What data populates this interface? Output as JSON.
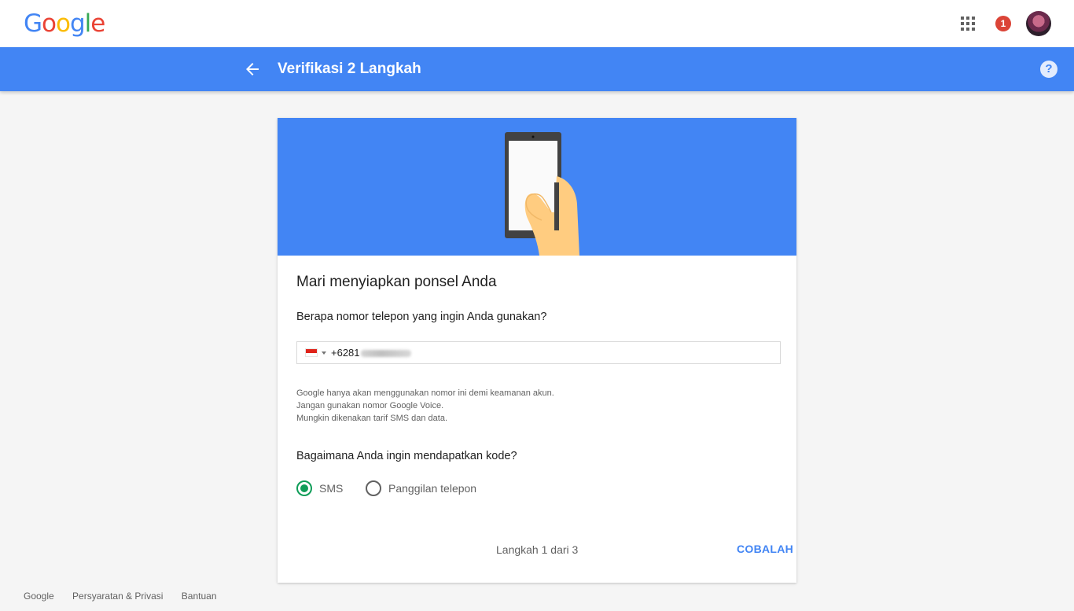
{
  "header": {
    "logo_letters": [
      {
        "char": "G",
        "color": "#4285f4"
      },
      {
        "char": "o",
        "color": "#ea4335"
      },
      {
        "char": "o",
        "color": "#fbbc05"
      },
      {
        "char": "g",
        "color": "#4285f4"
      },
      {
        "char": "l",
        "color": "#34a853"
      },
      {
        "char": "e",
        "color": "#ea4335"
      }
    ],
    "apps_icon": "grid-icon",
    "notification_count": "1",
    "avatar_icon": "user-avatar"
  },
  "appbar": {
    "title": "Verifikasi 2 Langkah",
    "back_icon": "arrow-left-icon",
    "help_icon": "?",
    "color": "#4285f4"
  },
  "card": {
    "hero_illustration": "hand-holding-phone",
    "title": "Mari menyiapkan ponsel Anda",
    "phone_question": "Berapa nomor telepon yang ingin Anda gunakan?",
    "phone": {
      "country_flag": "flag-indonesia-icon",
      "visible_prefix": "+6281"
    },
    "info_lines": [
      "Google hanya akan menggunakan nomor ini demi keamanan akun.",
      "Jangan gunakan nomor Google Voice.",
      "Mungkin dikenakan tarif SMS dan data."
    ],
    "code_question": "Bagaimana Anda ingin mendapatkan kode?",
    "options": [
      {
        "label": "SMS",
        "checked": true
      },
      {
        "label": "Panggilan telepon",
        "checked": false
      }
    ],
    "step_text": "Langkah 1 dari 3",
    "next_label": "COBALAH",
    "accent_color": "#0f9d58"
  },
  "footer": {
    "links": [
      "Google",
      "Persyaratan & Privasi",
      "Bantuan"
    ]
  }
}
